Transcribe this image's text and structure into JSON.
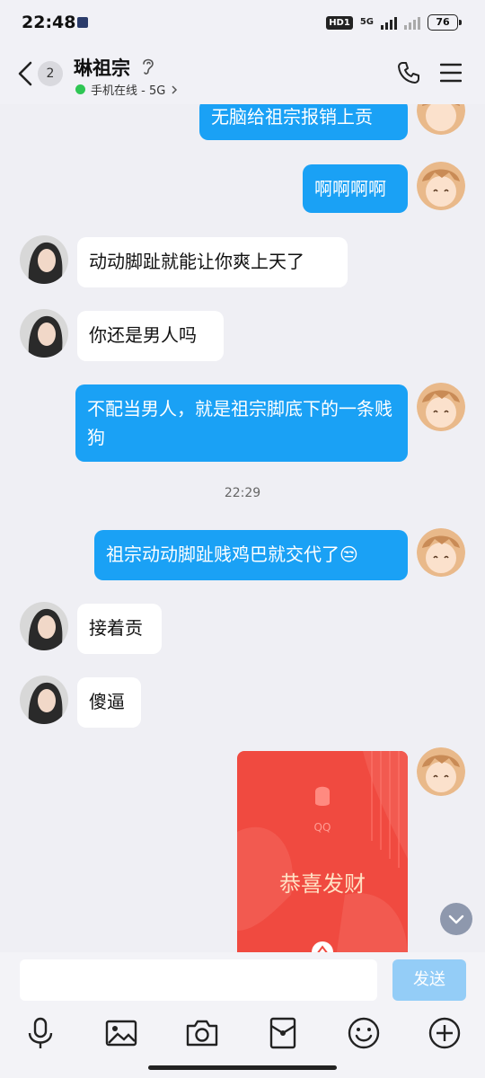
{
  "status_bar": {
    "time": "22:48",
    "hd_badge": "HD1",
    "network": "5G",
    "battery": "76"
  },
  "header": {
    "unread_count": "2",
    "title": "琳祖宗",
    "online_status": "手机在线 - 5G"
  },
  "messages": [
    {
      "side": "me",
      "text": "无脑给祖宗报销上贡"
    },
    {
      "side": "me",
      "text": "啊啊啊啊"
    },
    {
      "side": "other",
      "text": "动动脚趾就能让你爽上天了"
    },
    {
      "side": "other",
      "text": "你还是男人吗"
    },
    {
      "side": "me",
      "text": "不配当男人，就是祖宗脚底下的一条贱狗"
    },
    {
      "side": "time",
      "text": "22:29"
    },
    {
      "side": "me",
      "text": "祖宗动动脚趾贱鸡巴就交代了😒"
    },
    {
      "side": "other",
      "text": "接着贡"
    },
    {
      "side": "other",
      "text": "傻逼"
    }
  ],
  "red_packet": {
    "brand": "QQ",
    "label": "恭喜发财"
  },
  "composer": {
    "send_label": "发送",
    "input_value": ""
  },
  "toolbar_icons": [
    "microphone-icon",
    "image-icon",
    "camera-icon",
    "red-packet-icon",
    "emoji-icon",
    "plus-icon"
  ],
  "colors": {
    "my_bubble": "#1aa1f5",
    "their_bubble": "#ffffff",
    "background": "#efeff4",
    "online": "#2fc654",
    "red_packet": "#f04a40"
  }
}
